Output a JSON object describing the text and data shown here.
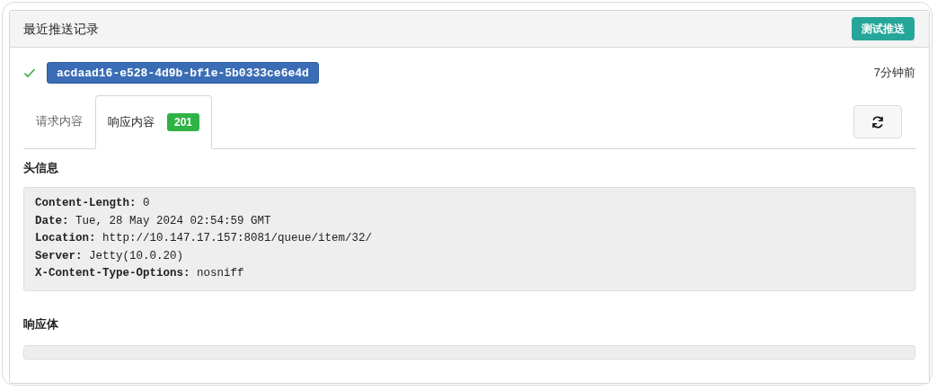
{
  "panel": {
    "title": "最近推送记录",
    "test_button": "测试推送"
  },
  "record": {
    "success": true,
    "id": "acdaad16-e528-4d9b-bf1e-5b0333ce6e4d",
    "time": "7分钟前"
  },
  "tabs": [
    {
      "label": "请求内容",
      "selected": false
    },
    {
      "label": "响应内容",
      "selected": true,
      "badge": "201"
    }
  ],
  "headers_section": {
    "title": "头信息",
    "headers": [
      {
        "name": "Content-Length:",
        "value": "0"
      },
      {
        "name": "Date:",
        "value": "Tue, 28 May 2024 02:54:59 GMT"
      },
      {
        "name": "Location:",
        "value": "http://10.147.17.157:8081/queue/item/32/"
      },
      {
        "name": "Server:",
        "value": "Jetty(10.0.20)"
      },
      {
        "name": "X-Content-Type-Options:",
        "value": "nosniff"
      }
    ]
  },
  "body_section": {
    "title": "响应体"
  }
}
